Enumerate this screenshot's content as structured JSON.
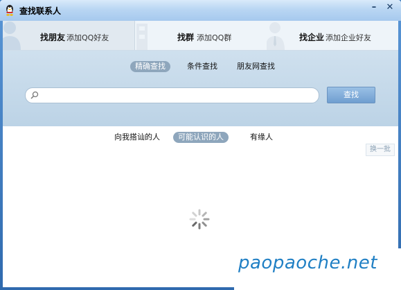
{
  "window": {
    "title": "查找联系人",
    "minimize_label": "–",
    "close_label": "✕"
  },
  "tabs": [
    {
      "title": "找朋友",
      "sub": "添加QQ好友",
      "active": true
    },
    {
      "title": "找群",
      "sub": "添加QQ群",
      "active": false
    },
    {
      "title": "找企业",
      "sub": "添加企业好友",
      "active": false
    }
  ],
  "search_modes": [
    {
      "label": "精确查找",
      "active": true
    },
    {
      "label": "条件查找",
      "active": false
    },
    {
      "label": "朋友网查找",
      "active": false
    }
  ],
  "search": {
    "value": "",
    "placeholder": "",
    "button_label": "查找"
  },
  "result_tabs": [
    {
      "label": "向我搭讪的人",
      "active": false
    },
    {
      "label": "可能认识的人",
      "active": true
    },
    {
      "label": "有缘人",
      "active": false
    }
  ],
  "refresh_label": "换一批",
  "watermark": "paopaoche.net"
}
